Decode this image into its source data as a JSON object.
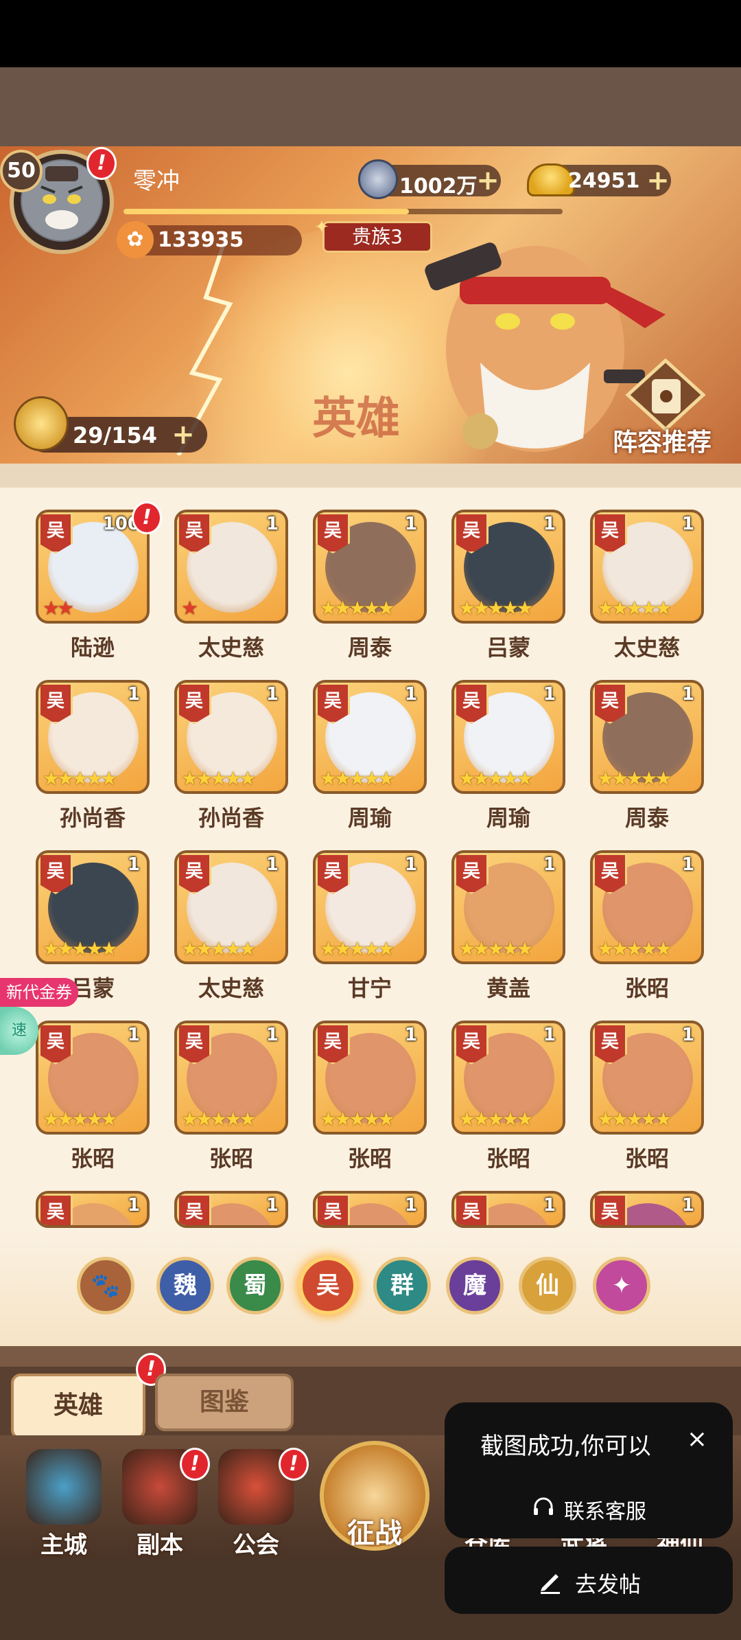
{
  "player": {
    "level": "50",
    "name": "零冲",
    "alert": "!",
    "coins": "1002万",
    "gold": "24951",
    "power": "133935",
    "noble": "贵族3",
    "xp_fraction": 0.65
  },
  "banner": {
    "watermark": "英雄",
    "hero_count": "29/154",
    "lineup_label": "阵容推荐"
  },
  "heroes": [
    {
      "name": "陆逊",
      "faction": "吴",
      "count": "100",
      "stars": "★★",
      "star_color": "red",
      "face": "#e9eef5",
      "alert": "!"
    },
    {
      "name": "太史慈",
      "faction": "吴",
      "count": "1",
      "stars": "★",
      "star_color": "red",
      "face": "#f1e7dc"
    },
    {
      "name": "周泰",
      "faction": "吴",
      "count": "1",
      "stars": "★★★★★",
      "star_color": "gold",
      "face": "#8f6e5c"
    },
    {
      "name": "吕蒙",
      "faction": "吴",
      "count": "1",
      "stars": "★★★★★",
      "star_color": "gold",
      "face": "#3c4650"
    },
    {
      "name": "太史慈",
      "faction": "吴",
      "count": "1",
      "stars": "★★★★★",
      "star_color": "gold",
      "face": "#f1e7dc"
    },
    {
      "name": "孙尚香",
      "faction": "吴",
      "count": "1",
      "stars": "★★★★★",
      "star_color": "gold",
      "face": "#f5e9dc"
    },
    {
      "name": "孙尚香",
      "faction": "吴",
      "count": "1",
      "stars": "★★★★★",
      "star_color": "gold",
      "face": "#f5e9dc"
    },
    {
      "name": "周瑜",
      "faction": "吴",
      "count": "1",
      "stars": "★★★★★",
      "star_color": "gold",
      "face": "#f0f2f6"
    },
    {
      "name": "周瑜",
      "faction": "吴",
      "count": "1",
      "stars": "★★★★★",
      "star_color": "gold",
      "face": "#f0f2f6"
    },
    {
      "name": "周泰",
      "faction": "吴",
      "count": "1",
      "stars": "★★★★★",
      "star_color": "gold",
      "face": "#8f6e5c"
    },
    {
      "name": "吕蒙",
      "faction": "吴",
      "count": "1",
      "stars": "★★★★★",
      "star_color": "gold",
      "face": "#3c4650"
    },
    {
      "name": "太史慈",
      "faction": "吴",
      "count": "1",
      "stars": "★★★★★",
      "star_color": "gold",
      "face": "#f1e7dc"
    },
    {
      "name": "甘宁",
      "faction": "吴",
      "count": "1",
      "stars": "★★★★★",
      "star_color": "gold",
      "face": "#f4e9e0"
    },
    {
      "name": "黄盖",
      "faction": "吴",
      "count": "1",
      "stars": "★★★★★",
      "star_color": "gold",
      "face": "#e5a36a"
    },
    {
      "name": "张昭",
      "faction": "吴",
      "count": "1",
      "stars": "★★★★★",
      "star_color": "gold",
      "face": "#e0956a"
    },
    {
      "name": "张昭",
      "faction": "吴",
      "count": "1",
      "stars": "★★★★★",
      "star_color": "gold",
      "face": "#e0956a"
    },
    {
      "name": "张昭",
      "faction": "吴",
      "count": "1",
      "stars": "★★★★★",
      "star_color": "gold",
      "face": "#e0956a"
    },
    {
      "name": "张昭",
      "faction": "吴",
      "count": "1",
      "stars": "★★★★★",
      "star_color": "gold",
      "face": "#e0956a"
    },
    {
      "name": "张昭",
      "faction": "吴",
      "count": "1",
      "stars": "★★★★★",
      "star_color": "gold",
      "face": "#e0956a"
    },
    {
      "name": "张昭",
      "faction": "吴",
      "count": "1",
      "stars": "★★★★★",
      "star_color": "gold",
      "face": "#e0956a"
    }
  ],
  "partial_row": [
    {
      "faction": "吴",
      "count": "1",
      "face": "#e5a36a"
    },
    {
      "faction": "吴",
      "count": "1",
      "face": "#e0956a"
    },
    {
      "faction": "吴",
      "count": "1",
      "face": "#e0956a"
    },
    {
      "faction": "吴",
      "count": "1",
      "face": "#e0956a"
    },
    {
      "faction": "吴",
      "count": "1",
      "face": "#b05a8a"
    }
  ],
  "factions": [
    {
      "label": "🐾",
      "name": "all",
      "color": "#a8633a"
    },
    {
      "label": "魏",
      "name": "wei",
      "color": "#3f5ea8"
    },
    {
      "label": "蜀",
      "name": "shu",
      "color": "#3a8a4a"
    },
    {
      "label": "吴",
      "name": "wu",
      "color": "#d04a2f",
      "selected": true
    },
    {
      "label": "群",
      "name": "qun",
      "color": "#2e8a84"
    },
    {
      "label": "魔",
      "name": "mo",
      "color": "#6a3f9a"
    },
    {
      "label": "仙",
      "name": "xian",
      "color": "#d8a13a"
    },
    {
      "label": "✦",
      "name": "mystic",
      "color": "#c24a9c"
    }
  ],
  "tabs": {
    "hero": "英雄",
    "codex": "图鉴"
  },
  "nav": [
    {
      "label": "主城",
      "icon": "castle-icon",
      "color": "#4aa0c8"
    },
    {
      "label": "副本",
      "icon": "sword-icon",
      "color": "#c84a3a"
    },
    {
      "label": "公会",
      "icon": "flag-icon",
      "color": "#d8503a"
    },
    {
      "label": "征战",
      "icon": "battle-icon",
      "color": "#e0a040"
    },
    {
      "label": "仓库",
      "icon": "warehouse-icon",
      "color": "#7a5a3a"
    },
    {
      "label": "武将",
      "icon": "general-icon",
      "color": "#7a5a3a"
    },
    {
      "label": "神仙",
      "icon": "deity-icon",
      "color": "#7a5a3a"
    }
  ],
  "toast": {
    "message": "截图成功,你可以",
    "close": "×",
    "customer_service": "联系客服",
    "post": "去发帖"
  },
  "floating": {
    "coupon": "新代金券",
    "speed": "速"
  }
}
